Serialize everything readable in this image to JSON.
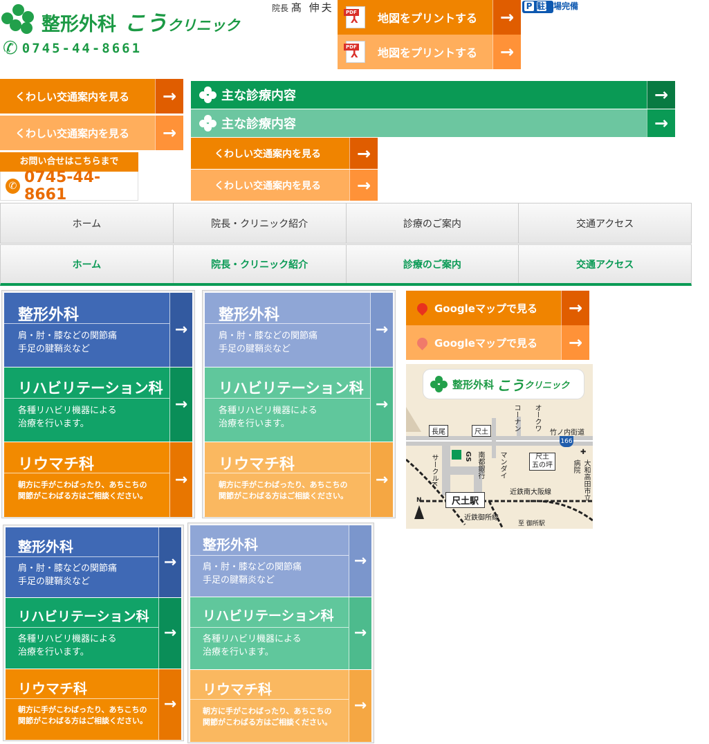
{
  "header": {
    "logo_main": "整形外科",
    "logo_sub": "こう",
    "logo_tail": "クリニック",
    "director_title": "院長",
    "director_name": "髙 伸夫",
    "phone": "0745-44-8661",
    "print_map_label": "地図をプリントする",
    "parking_icon": "P",
    "parking_label": "駐車場完備"
  },
  "buttons": {
    "transport_label": "くわしい交通案内を見る",
    "main_treatment_label": "主な診療内容",
    "google_map_label": "Googleマップで見る"
  },
  "contact": {
    "heading": "お問い合せはこちらまで",
    "phone": "0745-44-8661"
  },
  "nav": {
    "items": [
      {
        "label": "ホーム"
      },
      {
        "label": "院長・クリニック紹介"
      },
      {
        "label": "診療のご案内"
      },
      {
        "label": "交通アクセス"
      }
    ]
  },
  "departments": [
    {
      "title": "整形外科",
      "desc1": "肩・肘・膝などの関節痛",
      "desc2": "手足の腱鞘炎など"
    },
    {
      "title": "リハビリテーション科",
      "desc1": "各種リハビリ機器による",
      "desc2": "治療を行います。"
    },
    {
      "title": "リウマチ科",
      "desc1": "朝方に手がこわばったり、あちこちの",
      "desc2": "関節がこわばる方はご相談ください。"
    }
  ],
  "map": {
    "logo_main": "整形外科",
    "logo_sub": "こう",
    "logo_tail": "クリニック",
    "labels": {
      "nagao": "長尾",
      "shakudo": "尺土",
      "shakudo_gotsubo_1": "尺土",
      "shakudo_gotsubo_2": "五の坪",
      "konan": "コーナン",
      "okuwa": "オークワ",
      "takenouchi": "竹ノ内街道",
      "route": "166",
      "gs": "GS",
      "nanto": "南都銀行",
      "mandai": "マンダイ",
      "circle_k": "サークルK",
      "hospital": "大和高田市立病院",
      "hospital_mark": "✚",
      "station": "尺土駅",
      "kintetsu_minami": "近鉄南大阪線",
      "kintetsu_gose": "近鉄御所線",
      "to_gose": "至 御所駅",
      "north": "N"
    }
  },
  "colors": {
    "green": "#0a9a55",
    "orange": "#f08400",
    "blue": "#3f69b5",
    "red": "#d9302a"
  },
  "icons": {
    "arrow": "→",
    "phone": "✆",
    "pdf_small": "PDF",
    "pdf_glyph": "⅄"
  }
}
